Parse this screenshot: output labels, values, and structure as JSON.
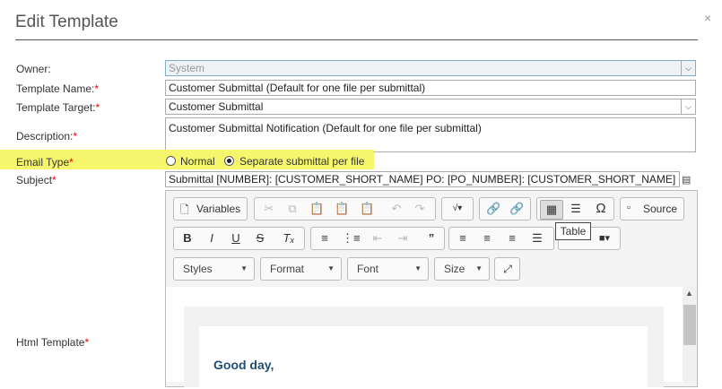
{
  "dialog": {
    "title": "Edit Template",
    "close_label": "×"
  },
  "form": {
    "owner": {
      "label": "Owner:",
      "value": "System"
    },
    "template_name": {
      "label": "Template Name:",
      "required": "*",
      "value": "Customer Submittal (Default for one file per submittal)"
    },
    "template_target": {
      "label": "Template Target:",
      "required": "*",
      "value": "Customer Submittal"
    },
    "description": {
      "label": "Description:",
      "required": "*",
      "value": "Customer Submittal Notification (Default for one file per submittal)"
    },
    "email_type": {
      "label": "Email Type",
      "required": "*",
      "options": [
        "Normal",
        "Separate submittal per file"
      ],
      "selected": "Separate submittal per file"
    },
    "subject": {
      "label": "Subject",
      "required": "*",
      "value": "Submittal [NUMBER]: [CUSTOMER_SHORT_NAME] PO: [PO_NUMBER]: [CUSTOMER_SHORT_NAME] Doc a"
    },
    "html_template": {
      "label": "Html Template",
      "required": "*"
    }
  },
  "editor": {
    "variables_label": "Variables",
    "source_label": "Source",
    "tooltip": "Table",
    "styles_label": "Styles",
    "format_label": "Format",
    "font_label": "Font",
    "size_label": "Size",
    "content_greeting": "Good day,"
  },
  "colors": {
    "highlight": "#f7f76e",
    "required": "#e00000",
    "greeting": "#1f4e79"
  }
}
